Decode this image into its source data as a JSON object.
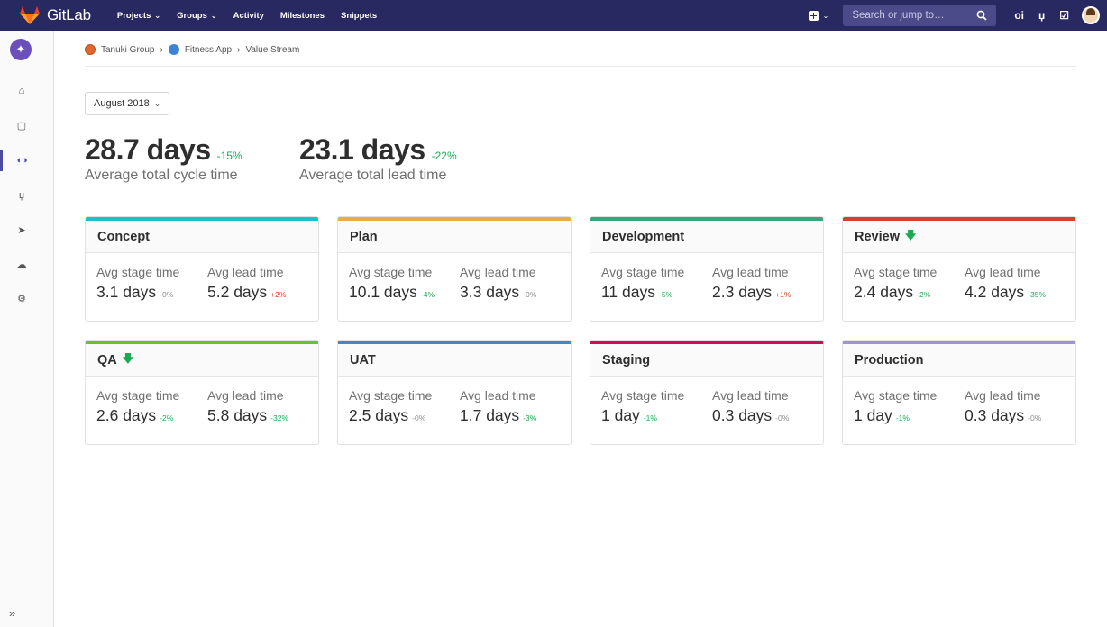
{
  "navbar": {
    "brand": "GitLab",
    "links": [
      {
        "label": "Projects",
        "dropdown": true
      },
      {
        "label": "Groups",
        "dropdown": true
      },
      {
        "label": "Activity",
        "dropdown": false
      },
      {
        "label": "Milestones",
        "dropdown": false
      },
      {
        "label": "Snippets",
        "dropdown": false
      }
    ],
    "search_placeholder": "Search or jump to…",
    "nav_color": "#292961"
  },
  "breadcrumb": {
    "group": "Tanuki Group",
    "project": "Fitness App",
    "page": "Value Stream"
  },
  "filter": {
    "period": "August 2018"
  },
  "summary": {
    "cycle": {
      "value": "28.7 days",
      "delta": "-15%",
      "label": "Average total cycle time"
    },
    "lead": {
      "value": "23.1 days",
      "delta": "-22%",
      "label": "Average total lead time"
    }
  },
  "labels": {
    "stage_time": "Avg stage time",
    "lead_time": "Avg lead time"
  },
  "stages": [
    {
      "name": "Concept",
      "color": "#1cbfce",
      "arrow": false,
      "stage_value": "3.1 days",
      "stage_delta": "-0%",
      "stage_delta_tone": "gray",
      "lead_value": "5.2 days",
      "lead_delta": "+2%",
      "lead_delta_tone": "red"
    },
    {
      "name": "Plan",
      "color": "#eda74d",
      "arrow": false,
      "stage_value": "10.1 days",
      "stage_delta": "-4%",
      "stage_delta_tone": "green",
      "lead_value": "3.3 days",
      "lead_delta": "-0%",
      "lead_delta_tone": "gray"
    },
    {
      "name": "Development",
      "color": "#3ba47c",
      "arrow": false,
      "stage_value": "11 days",
      "stage_delta": "-5%",
      "stage_delta_tone": "green",
      "lead_value": "2.3 days",
      "lead_delta": "+1%",
      "lead_delta_tone": "red"
    },
    {
      "name": "Review",
      "color": "#d5402b",
      "arrow": true,
      "stage_value": "2.4 days",
      "stage_delta": "-2%",
      "stage_delta_tone": "green",
      "lead_value": "4.2 days",
      "lead_delta": "-35%",
      "lead_delta_tone": "green"
    },
    {
      "name": "QA",
      "color": "#6bc127",
      "arrow": true,
      "stage_value": "2.6 days",
      "stage_delta": "-2%",
      "stage_delta_tone": "green",
      "lead_value": "5.8 days",
      "lead_delta": "-32%",
      "lead_delta_tone": "green"
    },
    {
      "name": "UAT",
      "color": "#3f86d0",
      "arrow": false,
      "stage_value": "2.5 days",
      "stage_delta": "-0%",
      "stage_delta_tone": "gray",
      "lead_value": "1.7 days",
      "lead_delta": "-3%",
      "lead_delta_tone": "green"
    },
    {
      "name": "Staging",
      "color": "#d10a57",
      "arrow": false,
      "stage_value": "1 day",
      "stage_delta": "-1%",
      "stage_delta_tone": "green",
      "lead_value": "0.3 days",
      "lead_delta": "-0%",
      "lead_delta_tone": "gray"
    },
    {
      "name": "Production",
      "color": "#a193d3",
      "arrow": false,
      "stage_value": "1 day",
      "stage_delta": "-1%",
      "stage_delta_tone": "green",
      "lead_value": "0.3 days",
      "lead_delta": "-0%",
      "lead_delta_tone": "gray"
    }
  ]
}
